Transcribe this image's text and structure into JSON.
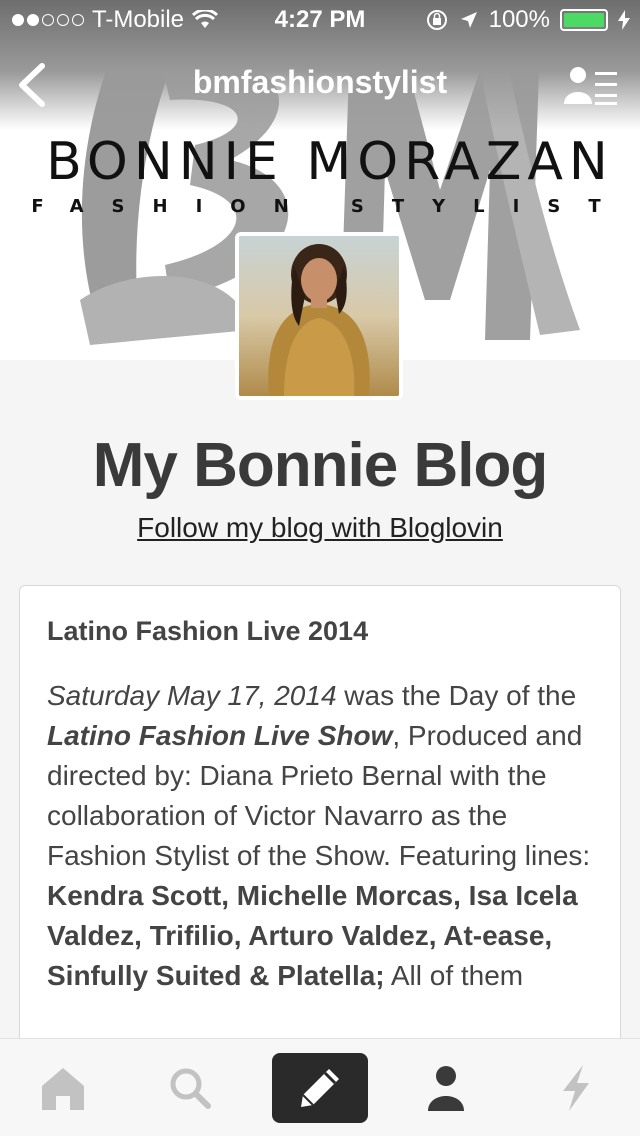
{
  "status_bar": {
    "carrier": "T-Mobile",
    "time": "4:27 PM",
    "battery": "100%",
    "signal_bars": 2,
    "icons": [
      "wifi-icon",
      "rotation-lock-icon",
      "location-icon",
      "battery-icon",
      "charging-icon"
    ]
  },
  "nav": {
    "title": "bmfashionstylist",
    "back_icon": "chevron-left-icon",
    "profile_icon": "profile-list-icon"
  },
  "header": {
    "brand_name": "BONNIE MORAZAN",
    "brand_subtitle": "FASHION STYLIST",
    "monogram": "BM"
  },
  "blog": {
    "title": "My Bonnie Blog",
    "follow_link": "Follow my blog with Bloglovin"
  },
  "post": {
    "title": "Latino Fashion Live 2014",
    "body": {
      "date_italic": "Saturday May 17, 2014",
      "text1": " was the Day of the ",
      "show_bold_italic": "Latino Fashion Live Show",
      "text2": ", Produced and directed by: Diana Prieto Bernal with the collaboration of Victor Navarro as the Fashion Stylist of the Show. Featuring lines: ",
      "lines_bold": "Kendra Scott, Michelle Morcas, Isa Icela Valdez, Trifilio, Arturo Valdez, At-ease, Sinfully Suited & Platella;",
      "text3": " All of them"
    }
  },
  "tabbar": {
    "items": [
      {
        "name": "home",
        "icon": "home-icon"
      },
      {
        "name": "search",
        "icon": "search-icon"
      },
      {
        "name": "compose",
        "icon": "pencil-icon"
      },
      {
        "name": "account",
        "icon": "person-icon"
      },
      {
        "name": "activity",
        "icon": "lightning-icon"
      }
    ]
  },
  "colors": {
    "battery": "#4cd964",
    "compose_bg": "#2a2a2a",
    "background": "#f5f5f5",
    "title_text": "#3a3a3a"
  }
}
